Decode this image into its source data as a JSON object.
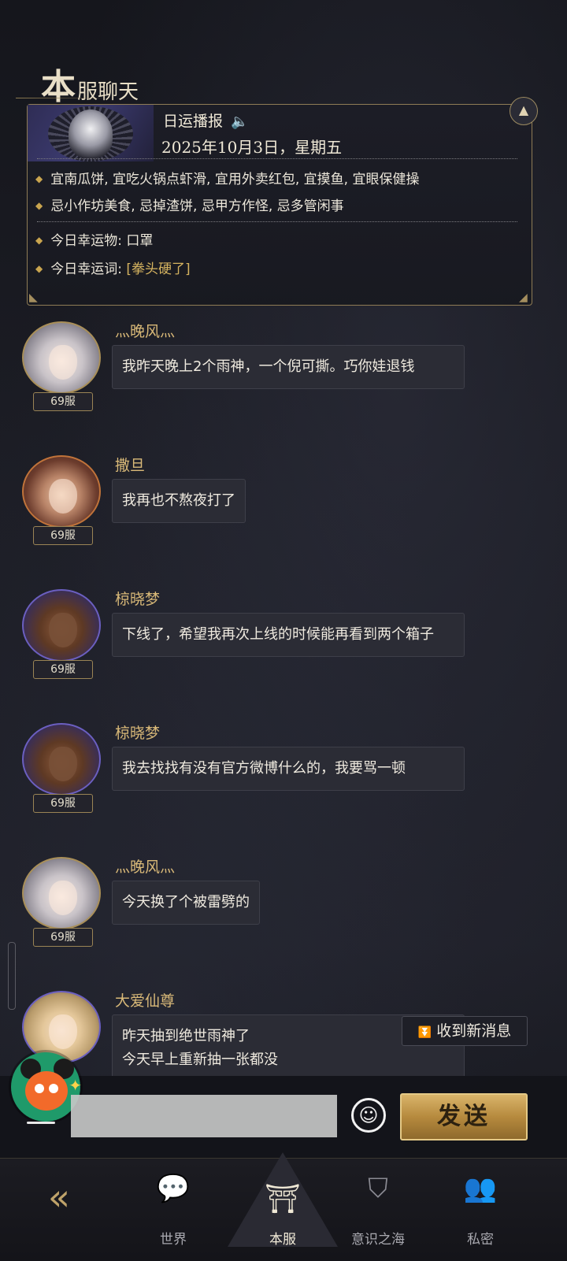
{
  "channel_title": {
    "first": "本",
    "rest": "服聊天"
  },
  "fortune": {
    "header": "日运播报",
    "speaker_icon": "speaker-icon",
    "date": "2025年10月3日，星期五",
    "good": "宜南瓜饼, 宜吃火锅点虾滑, 宜用外卖红包, 宜摸鱼, 宜眼保健操",
    "bad": "忌小作坊美食, 忌掉渣饼, 忌甲方作怪, 忌多管闲事",
    "lucky_item_label": "今日幸运物:",
    "lucky_item": "口罩",
    "lucky_word_label": "今日幸运词:",
    "lucky_word": "[拳头硬了]"
  },
  "messages": [
    {
      "user": "灬晚风灬",
      "server": "69服",
      "text": "我昨天晚上2个雨神，一个倪可撕。巧你娃退钱"
    },
    {
      "user": "撒旦",
      "server": "69服",
      "text": "我再也不熬夜打了"
    },
    {
      "user": "椋晓梦",
      "server": "69服",
      "text": "下线了，希望我再次上线的时候能再看到两个箱子"
    },
    {
      "user": "椋晓梦",
      "server": "69服",
      "text": "我去找找有没有官方微博什么的，我要骂一顿"
    },
    {
      "user": "灬晚风灬",
      "server": "69服",
      "text": "今天换了个被雷劈的"
    },
    {
      "user": "大爱仙尊",
      "server": "",
      "text": "昨天抽到绝世雨神了\n今天早上重新抽一张都没"
    }
  ],
  "new_messages": "收到新消息",
  "composer": {
    "placeholder": "",
    "send": "发送"
  },
  "nav": {
    "world": "世界",
    "local": "本服",
    "sea": "意识之海",
    "private": "私密"
  },
  "colors": {
    "gold": "#d6b460",
    "accent_border": "#8f7c55"
  }
}
